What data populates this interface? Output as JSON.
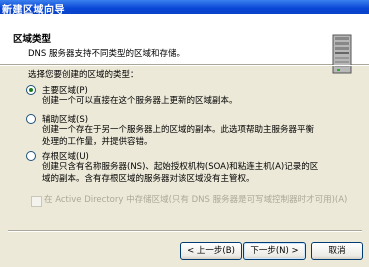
{
  "window": {
    "title": "新建区域向导"
  },
  "header": {
    "title": "区域类型",
    "subtitle": "DNS 服务器支持不同类型的区域和存储。"
  },
  "prompt": "选择您要创建的区域的类型：",
  "options": [
    {
      "label": "主要区域(P)",
      "selected": true,
      "desc_lines": [
        "创建一个可以直接在这个服务器上更新的区域副本。"
      ]
    },
    {
      "label": "辅助区域(S)",
      "selected": false,
      "desc_lines": [
        "创建一个存在于另一个服务器上的区域的副本。此选项帮助主服务器平衡",
        "处理的工作量，并提供容错。"
      ]
    },
    {
      "label": "存根区域(U)",
      "selected": false,
      "desc_lines": [
        "创建只含有名称服务器(NS)、起始授权机构(SOA)和粘连主机(A)记录的区",
        "域的副本。含有存根区域的服务器对该区域没有主管权。"
      ]
    }
  ],
  "ad_checkbox": {
    "label": "在 Active Directory 中存储区域(只有 DNS 服务器是可写域控制器时才可用)(A)",
    "checked": false,
    "enabled": false
  },
  "buttons": {
    "back": "< 上一步(B)",
    "next": "下一步(N) >",
    "cancel": "取消"
  }
}
